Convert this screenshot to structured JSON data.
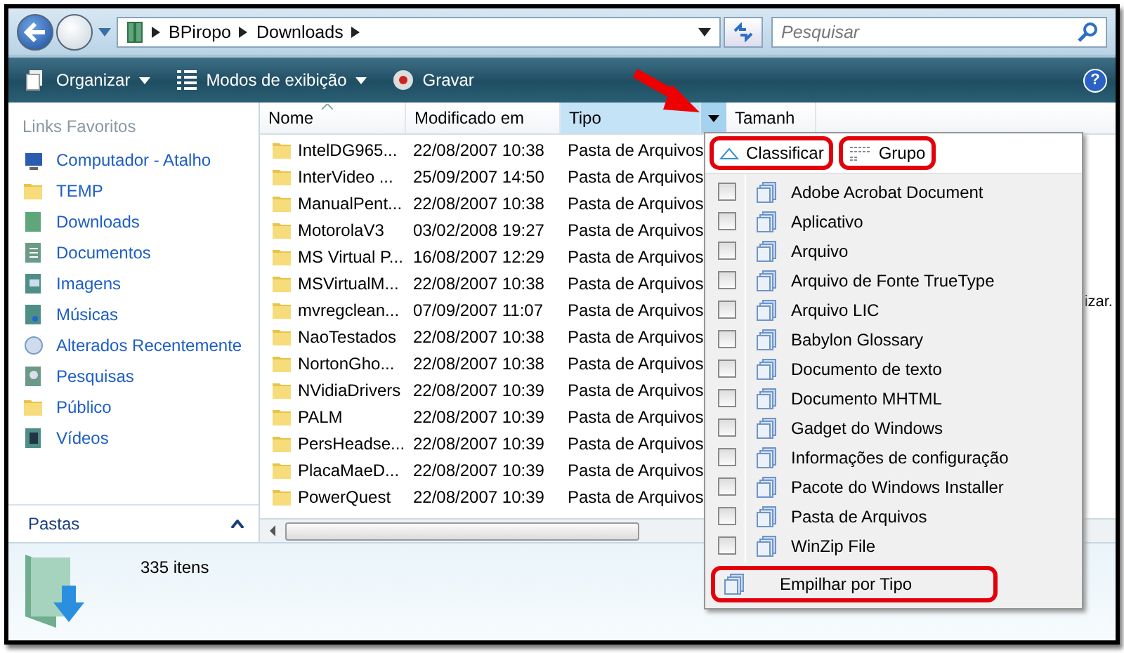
{
  "address": {
    "breadcrumb": [
      "BPiropo",
      "Downloads"
    ]
  },
  "search": {
    "placeholder": "Pesquisar"
  },
  "toolbar": [
    {
      "label": "Organizar",
      "kind": "menu"
    },
    {
      "label": "Modos de exibição",
      "kind": "menu"
    },
    {
      "label": "Gravar",
      "kind": "button"
    }
  ],
  "help": {
    "label": "?"
  },
  "sidebar": {
    "title": "Links Favoritos",
    "items": [
      {
        "label": "Computador - Atalho"
      },
      {
        "label": "TEMP"
      },
      {
        "label": "Downloads"
      },
      {
        "label": "Documentos"
      },
      {
        "label": "Imagens"
      },
      {
        "label": "Músicas"
      },
      {
        "label": "Alterados Recentemente"
      },
      {
        "label": "Pesquisas"
      },
      {
        "label": "Público"
      },
      {
        "label": "Vídeos"
      }
    ],
    "folders_label": "Pastas"
  },
  "table": {
    "columns": [
      {
        "label": "Nome",
        "selected": false
      },
      {
        "label": "Modificado em",
        "selected": false
      },
      {
        "label": "Tipo",
        "selected": true
      },
      {
        "label": "Tamanh",
        "selected": false
      }
    ],
    "rows": [
      {
        "name": "IntelDG965...",
        "modified": "22/08/2007 10:38",
        "type": "Pasta de Arquivos"
      },
      {
        "name": "InterVideo ...",
        "modified": "25/09/2007 14:50",
        "type": "Pasta de Arquivos"
      },
      {
        "name": "ManualPent...",
        "modified": "22/08/2007 10:38",
        "type": "Pasta de Arquivos"
      },
      {
        "name": "MotorolaV3",
        "modified": "03/02/2008 19:27",
        "type": "Pasta de Arquivos"
      },
      {
        "name": "MS Virtual P...",
        "modified": "16/08/2007 12:29",
        "type": "Pasta de Arquivos"
      },
      {
        "name": "MSVirtualM...",
        "modified": "22/08/2007 10:38",
        "type": "Pasta de Arquivos"
      },
      {
        "name": "mvregclean...",
        "modified": "07/09/2007 11:07",
        "type": "Pasta de Arquivos"
      },
      {
        "name": "NaoTestados",
        "modified": "22/08/2007 10:38",
        "type": "Pasta de Arquivos"
      },
      {
        "name": "NortonGho...",
        "modified": "22/08/2007 10:38",
        "type": "Pasta de Arquivos"
      },
      {
        "name": "NVidiaDrivers",
        "modified": "22/08/2007 10:39",
        "type": "Pasta de Arquivos"
      },
      {
        "name": "PALM",
        "modified": "22/08/2007 10:39",
        "type": "Pasta de Arquivos"
      },
      {
        "name": "PersHeadse...",
        "modified": "22/08/2007 10:39",
        "type": "Pasta de Arquivos"
      },
      {
        "name": "PlacaMaeD...",
        "modified": "22/08/2007 10:39",
        "type": "Pasta de Arquivos"
      },
      {
        "name": "PowerQuest",
        "modified": "22/08/2007 10:39",
        "type": "Pasta de Arquivos"
      }
    ],
    "background_text": "izar."
  },
  "column_menu": {
    "sort": {
      "label": "Classificar",
      "highlighted": true
    },
    "group": {
      "label": "Grupo",
      "highlighted": true
    },
    "filters": [
      {
        "label": "Adobe Acrobat Document",
        "checked": false
      },
      {
        "label": "Aplicativo",
        "checked": false
      },
      {
        "label": "Arquivo",
        "checked": false
      },
      {
        "label": "Arquivo de Fonte TrueType",
        "checked": false
      },
      {
        "label": "Arquivo LIC",
        "checked": false
      },
      {
        "label": "Babylon Glossary",
        "checked": false
      },
      {
        "label": "Documento de texto",
        "checked": false
      },
      {
        "label": "Documento MHTML",
        "checked": false
      },
      {
        "label": "Gadget do Windows",
        "checked": false
      },
      {
        "label": "Informações de configuração",
        "checked": false
      },
      {
        "label": "Pacote do Windows Installer",
        "checked": false
      },
      {
        "label": "Pasta de Arquivos",
        "checked": false
      },
      {
        "label": "WinZip File",
        "checked": false
      }
    ],
    "stack": {
      "label": "Empilhar por Tipo",
      "highlighted": true
    }
  },
  "details": {
    "count": "335 itens"
  }
}
